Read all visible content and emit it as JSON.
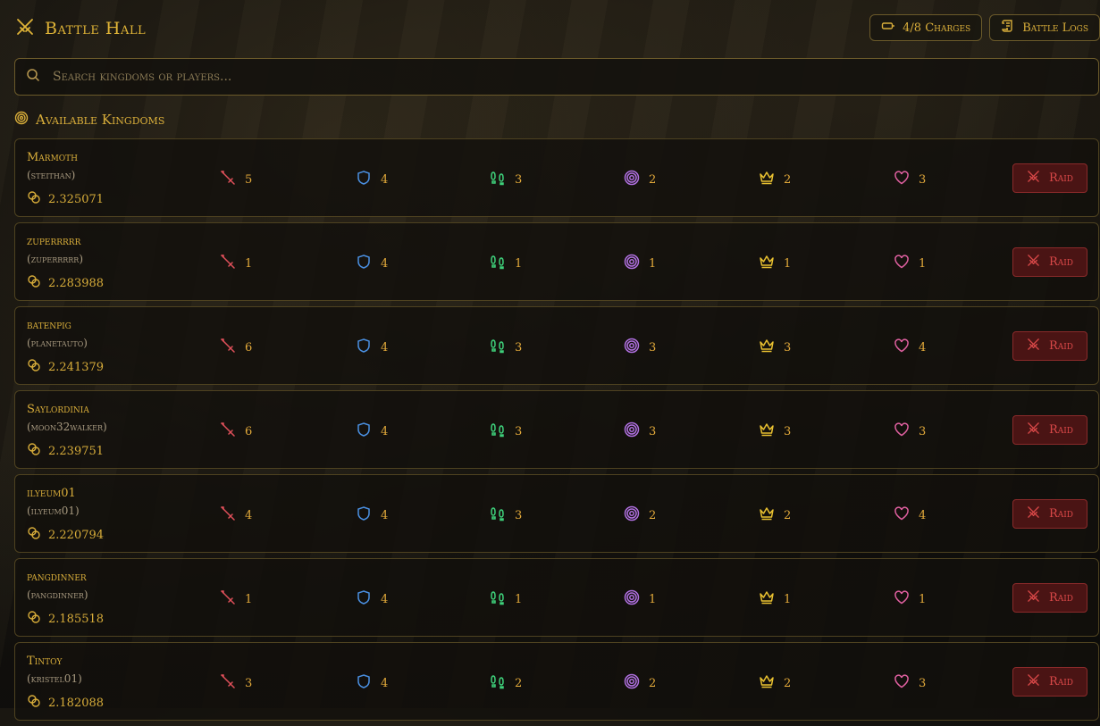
{
  "header": {
    "title": "Battle Hall",
    "charges_label": "4/8 Charges",
    "logs_label": "Battle Logs"
  },
  "search": {
    "placeholder": "Search kingdoms or players..."
  },
  "section": {
    "title": "Available Kingdoms"
  },
  "raid_label": "Raid",
  "kingdoms": [
    {
      "name": "Marmoth",
      "player": "(steithan)",
      "gold": "2.325071",
      "attack": "5",
      "defense": "4",
      "speed": "3",
      "accuracy": "2",
      "leadership": "2",
      "health": "3"
    },
    {
      "name": "zuperrrrr",
      "player": "(zuperrrrr)",
      "gold": "2.283988",
      "attack": "1",
      "defense": "4",
      "speed": "1",
      "accuracy": "1",
      "leadership": "1",
      "health": "1"
    },
    {
      "name": "batenpig",
      "player": "(planetauto)",
      "gold": "2.241379",
      "attack": "6",
      "defense": "4",
      "speed": "3",
      "accuracy": "3",
      "leadership": "3",
      "health": "4"
    },
    {
      "name": "Saylordinia",
      "player": "(moon32walker)",
      "gold": "2.239751",
      "attack": "6",
      "defense": "4",
      "speed": "3",
      "accuracy": "3",
      "leadership": "3",
      "health": "3"
    },
    {
      "name": "ilyeum01",
      "player": "(ilyeum01)",
      "gold": "2.220794",
      "attack": "4",
      "defense": "4",
      "speed": "3",
      "accuracy": "2",
      "leadership": "2",
      "health": "4"
    },
    {
      "name": "pangdinner",
      "player": "(pangdinner)",
      "gold": "2.185518",
      "attack": "1",
      "defense": "4",
      "speed": "1",
      "accuracy": "1",
      "leadership": "1",
      "health": "1"
    },
    {
      "name": "Tintoy",
      "player": "(kristel01)",
      "gold": "2.182088",
      "attack": "3",
      "defense": "4",
      "speed": "2",
      "accuracy": "2",
      "leadership": "2",
      "health": "3"
    }
  ],
  "colors": {
    "accent": "#d8ad3a",
    "attack": "#e0505a",
    "defense": "#4a8fe0",
    "speed": "#3ecf7a",
    "accuracy": "#b070e0",
    "leadership": "#e8c030",
    "health": "#e060a0",
    "raid": "#d94848"
  }
}
